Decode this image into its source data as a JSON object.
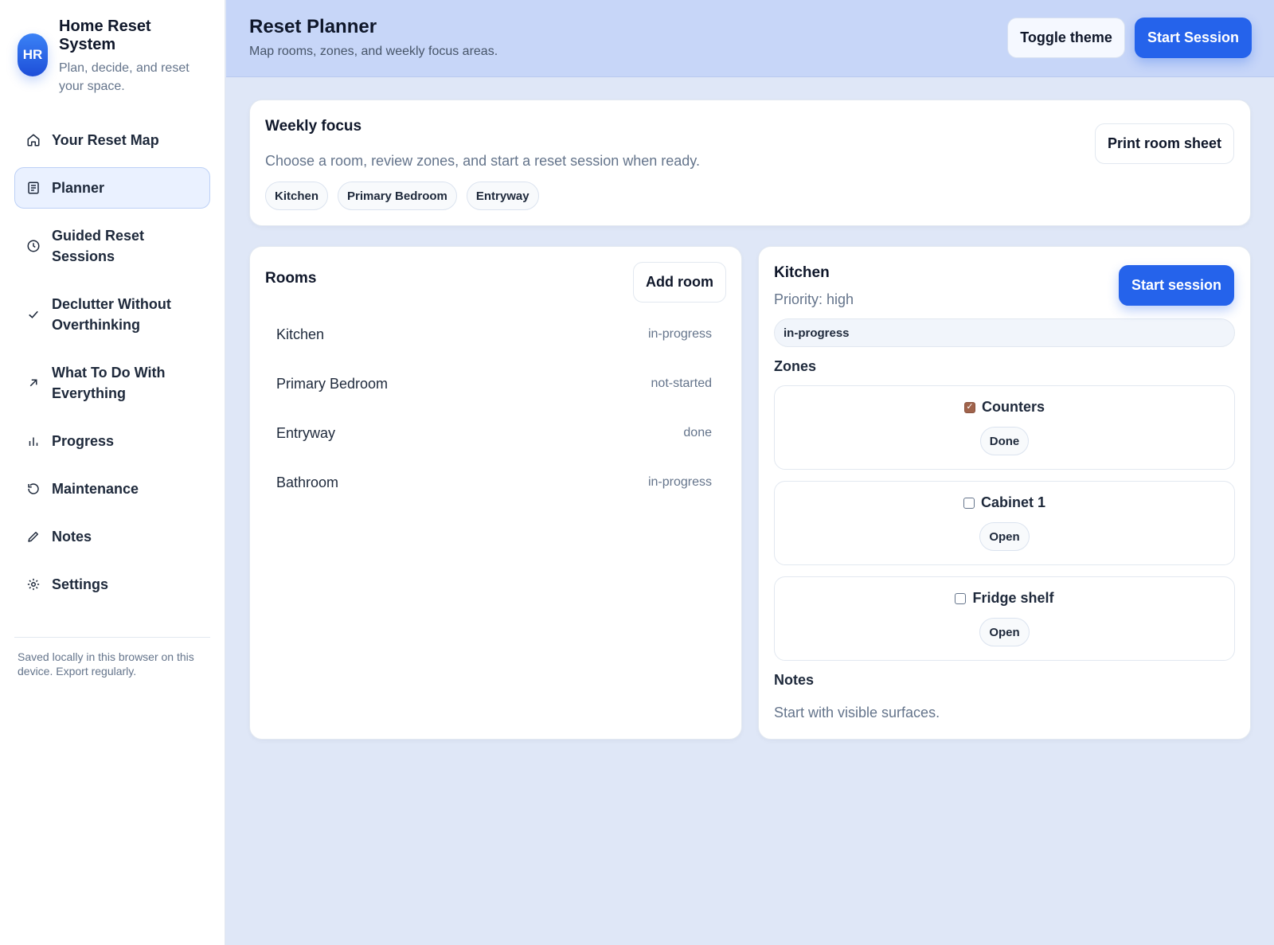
{
  "brand": {
    "initials": "HR",
    "title": "Home Reset System",
    "subtitle": "Plan, decide, and reset your space."
  },
  "nav": {
    "items": [
      {
        "label": "Your Reset Map",
        "icon": "home-icon"
      },
      {
        "label": "Planner",
        "icon": "planner-icon",
        "active": true
      },
      {
        "label": "Guided Reset Sessions",
        "icon": "clock-icon"
      },
      {
        "label": "Declutter Without Overthinking",
        "icon": "check-icon"
      },
      {
        "label": "What To Do With Everything",
        "icon": "arrow-up-right-icon"
      },
      {
        "label": "Progress",
        "icon": "bar-chart-icon"
      },
      {
        "label": "Maintenance",
        "icon": "refresh-icon"
      },
      {
        "label": "Notes",
        "icon": "pencil-icon"
      },
      {
        "label": "Settings",
        "icon": "gear-icon"
      }
    ]
  },
  "sidebar_footer": "Saved locally in this browser on this device. Export regularly.",
  "header": {
    "title": "Reset Planner",
    "subtitle": "Map rooms, zones, and weekly focus areas.",
    "toggle_theme_label": "Toggle theme",
    "start_session_label": "Start Session"
  },
  "weekly_focus": {
    "title": "Weekly focus",
    "description": "Choose a room, review zones, and start a reset session when ready.",
    "print_label": "Print room sheet",
    "chips": [
      "Kitchen",
      "Primary Bedroom",
      "Entryway"
    ]
  },
  "rooms": {
    "title": "Rooms",
    "add_label": "Add room",
    "items": [
      {
        "name": "Kitchen",
        "status": "in-progress"
      },
      {
        "name": "Primary Bedroom",
        "status": "not-started"
      },
      {
        "name": "Entryway",
        "status": "done"
      },
      {
        "name": "Bathroom",
        "status": "in-progress"
      }
    ]
  },
  "detail": {
    "title": "Kitchen",
    "priority": "Priority: high",
    "start_label": "Start session",
    "status": "in-progress",
    "zones_label": "Zones",
    "zones": [
      {
        "label": "Counters",
        "checked": true,
        "badge": "Done"
      },
      {
        "label": "Cabinet 1",
        "checked": false,
        "badge": "Open"
      },
      {
        "label": "Fridge shelf",
        "checked": false,
        "badge": "Open"
      }
    ],
    "notes_label": "Notes",
    "notes_text": "Start with visible surfaces."
  },
  "colors": {
    "accent": "#2563eb",
    "header_bg": "#c7d6f8",
    "page_bg": "#dfe7f7",
    "checkbox_checked": "#a0634b"
  }
}
